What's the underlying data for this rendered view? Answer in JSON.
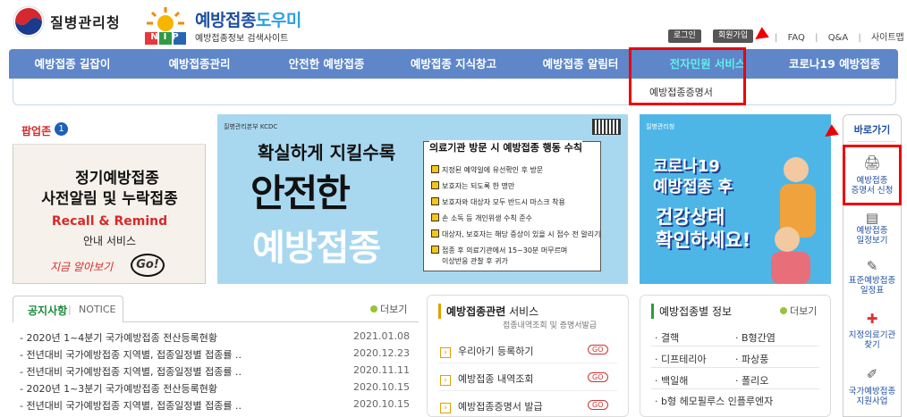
{
  "header": {
    "org_name": "질병관리청",
    "nip_logo_text": "NIP",
    "site_title_a": "예방접종",
    "site_title_b": "도우미",
    "site_subtitle": "예방접종정보 검색사이트",
    "login_label": "로그인",
    "join_label": "회원가입",
    "top_links": [
      "FAQ",
      "Q&A",
      "사이트맵"
    ]
  },
  "nav": {
    "items": [
      "예방접종 길잡이",
      "예방접종관리",
      "안전한 예방접종",
      "예방접종 지식창고",
      "예방접종 알림터",
      "전자민원 서비스",
      "코로나19 예방접종"
    ],
    "active_index": 5,
    "sub_item": "예방접종증명서"
  },
  "popup": {
    "title": "팝업존",
    "number": "1",
    "line1": "정기예방접종",
    "line2": "사전알림 및 누락접종",
    "line3": "Recall & Remind",
    "line4": "안내 서비스",
    "line5": "지금 알아보기",
    "go_text": "Go!"
  },
  "banner_main": {
    "logo_text": "질병관리본부 KCDC",
    "line1": "확실하게 지킬수록",
    "line2": "안전한",
    "line3": "예방접종",
    "box_title": "의료기관 방문 시 예방접종 행동 수칙",
    "items": [
      "지정된 예약일에 유선확인 후 방문",
      "보호자는 되도록 한 명만",
      "보호자와 대상자 모두 반드시 마스크 착용",
      "손 소독 등 개인위생 수칙 준수",
      "대상자, 보호자는 해당 증상이 있을 시 접수 전 알리기",
      "접종 후 의료기관에서 15~30분 머무르며",
      "이상반응 관찰 후 귀가"
    ]
  },
  "banner_covid": {
    "logo_text": "질병관리청",
    "line1": "코로나19",
    "line2": "예방접종 후",
    "line3": "건강상태",
    "line4": "확인하세요!"
  },
  "quick": {
    "title": "바로가기",
    "items": [
      {
        "label1": "예방접종",
        "label2": "증명서 신청"
      },
      {
        "label1": "예방접종",
        "label2": "일정보기"
      },
      {
        "label1": "표준예방접종",
        "label2": "일정표"
      },
      {
        "label1": "지정의료기관",
        "label2": "찾기"
      },
      {
        "label1": "국가예방접종",
        "label2": "지원사업"
      }
    ]
  },
  "notice": {
    "title": "공지사항",
    "title_en": "NOTICE",
    "more": "더보기",
    "rows": [
      {
        "title": "2020년 1~4분기 국가예방접종 전산등록현황",
        "date": "2021.01.08"
      },
      {
        "title": "전년대비 국가예방접종 지역별, 접종일정별 접종률 ..",
        "date": "2020.12.23"
      },
      {
        "title": "전년대비 국가예방접종 지역별, 접종일정별 접종률 ..",
        "date": "2020.11.11"
      },
      {
        "title": "2020년 1~3분기 국가예방접종 전산등록현황",
        "date": "2020.10.15"
      },
      {
        "title": "전년대비 국가예방접종 지역별, 접종일정별 접종률 ..",
        "date": "2020.10.15"
      }
    ]
  },
  "services": {
    "title_bold": "예방접종관련",
    "title_rest": " 서비스",
    "subtitle": "접종내역조회 및 증명서발급",
    "go_label": "GO",
    "rows": [
      "우리아기 등록하기",
      "예방접종 내역조회",
      "예방접종증명서 발급"
    ]
  },
  "vaccine_info": {
    "title": "예방접종별 정보",
    "more": "더보기",
    "cells": [
      [
        "결핵",
        "B형간염"
      ],
      [
        "디프테리아",
        "파상풍"
      ],
      [
        "백일해",
        "폴리오"
      ],
      [
        "b형 헤모필루스 인플루엔자",
        ""
      ]
    ]
  },
  "colors": {
    "nav_bg": "#5f86c9",
    "nav_active": "#5ff0ea",
    "highlight_red": "#e00000",
    "notice_green": "#1a8a3a"
  }
}
